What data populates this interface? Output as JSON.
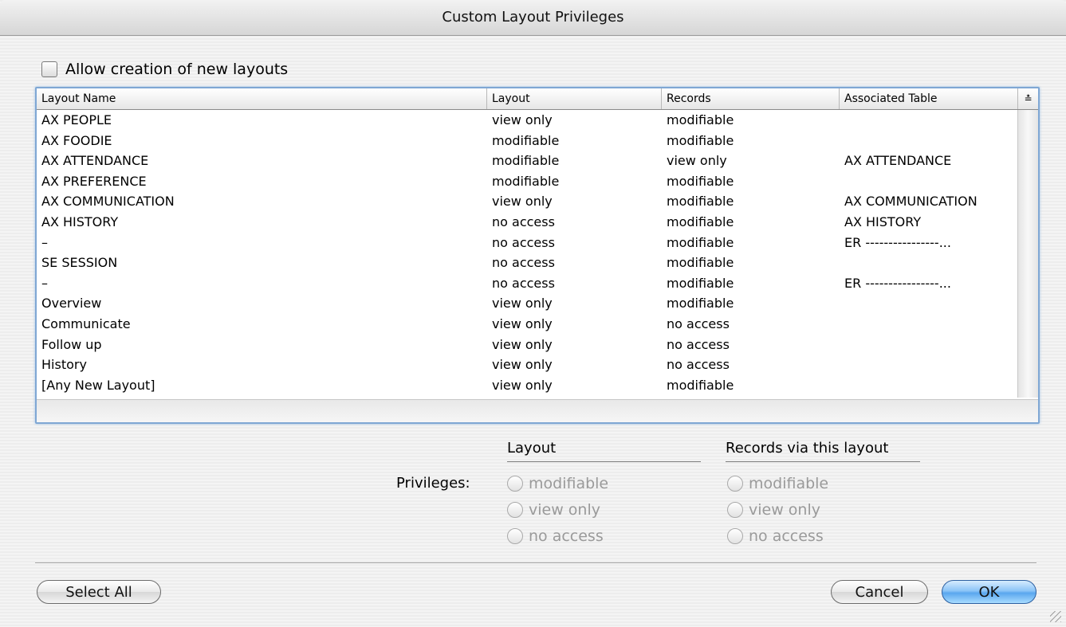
{
  "window": {
    "title": "Custom Layout Privileges"
  },
  "allow_new_layouts": {
    "label": "Allow creation of new layouts",
    "checked": false
  },
  "table": {
    "columns": [
      "Layout Name",
      "Layout",
      "Records",
      "Associated Table"
    ],
    "sort_indicator": "≛",
    "rows": [
      [
        "AX PEOPLE",
        "view only",
        "modifiable",
        ""
      ],
      [
        "AX FOODIE",
        "modifiable",
        "modifiable",
        ""
      ],
      [
        "AX ATTENDANCE",
        "modifiable",
        "view only",
        "AX ATTENDANCE"
      ],
      [
        "AX PREFERENCE",
        "modifiable",
        "modifiable",
        ""
      ],
      [
        "AX COMMUNICATION",
        "view only",
        "modifiable",
        "AX COMMUNICATION"
      ],
      [
        "AX HISTORY",
        "no access",
        "modifiable",
        "AX HISTORY"
      ],
      [
        "–",
        "no access",
        "modifiable",
        "ER ----------------..."
      ],
      [
        "SE SESSION",
        "no access",
        "modifiable",
        ""
      ],
      [
        "–",
        "no access",
        "modifiable",
        "ER ----------------..."
      ],
      [
        "Overview",
        "view only",
        "modifiable",
        ""
      ],
      [
        "Communicate",
        "view only",
        "no access",
        ""
      ],
      [
        "Follow up",
        "view only",
        "no access",
        ""
      ],
      [
        "History",
        "view only",
        "no access",
        ""
      ],
      [
        "[Any New Layout]",
        "view only",
        "modifiable",
        ""
      ]
    ]
  },
  "privileges": {
    "label": "Privileges:",
    "layout_heading": "Layout",
    "records_heading": "Records via this layout",
    "layout_options": [
      "modifiable",
      "view only",
      "no access"
    ],
    "records_options": [
      "modifiable",
      "view only",
      "no access"
    ]
  },
  "buttons": {
    "select_all": "Select All",
    "cancel": "Cancel",
    "ok": "OK"
  }
}
